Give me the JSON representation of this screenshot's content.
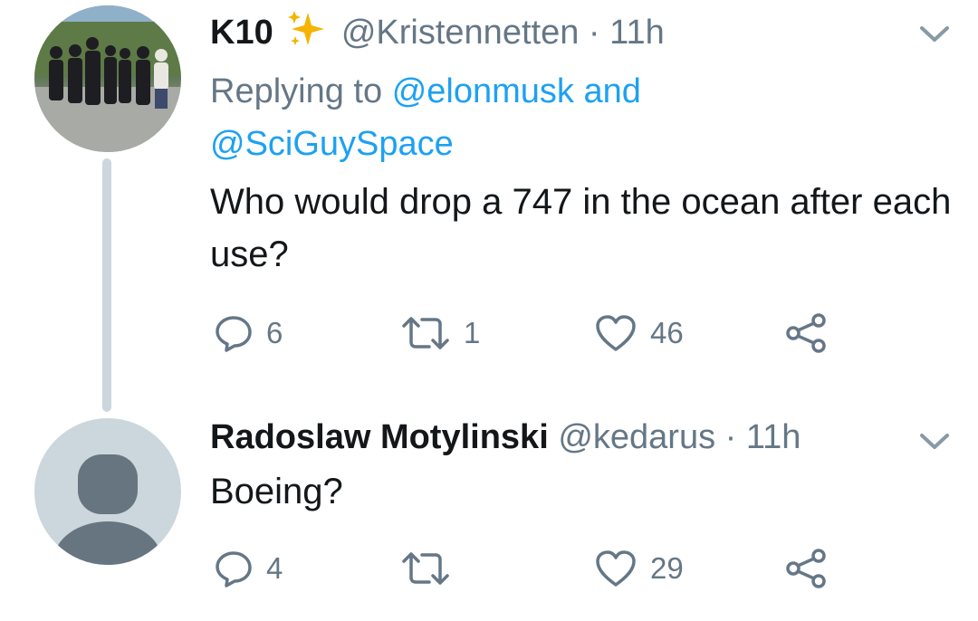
{
  "tweets": [
    {
      "name": "K10",
      "badge_icon": "sparkles-icon",
      "handle": "@Kristennetten",
      "separator": "·",
      "time": "11h",
      "replying_prefix": "Replying to",
      "replying_user1": "@elonmusk",
      "replying_and": "and",
      "replying_user2": "@SciGuySpace",
      "text": "Who would drop a 747 in the ocean after each use?",
      "replies": "6",
      "retweets": "1",
      "likes": "46"
    },
    {
      "name": "Radoslaw Motylinski",
      "handle": "@kedarus",
      "separator": "·",
      "time": "11h",
      "text": "Boeing?",
      "replies": "4",
      "retweets": "",
      "likes": "29"
    }
  ],
  "colors": {
    "text": "#14171a",
    "secondary": "#657786",
    "link": "#1da1f2",
    "thread_line": "#ccd6dd",
    "sparkle": "#f4b400"
  }
}
